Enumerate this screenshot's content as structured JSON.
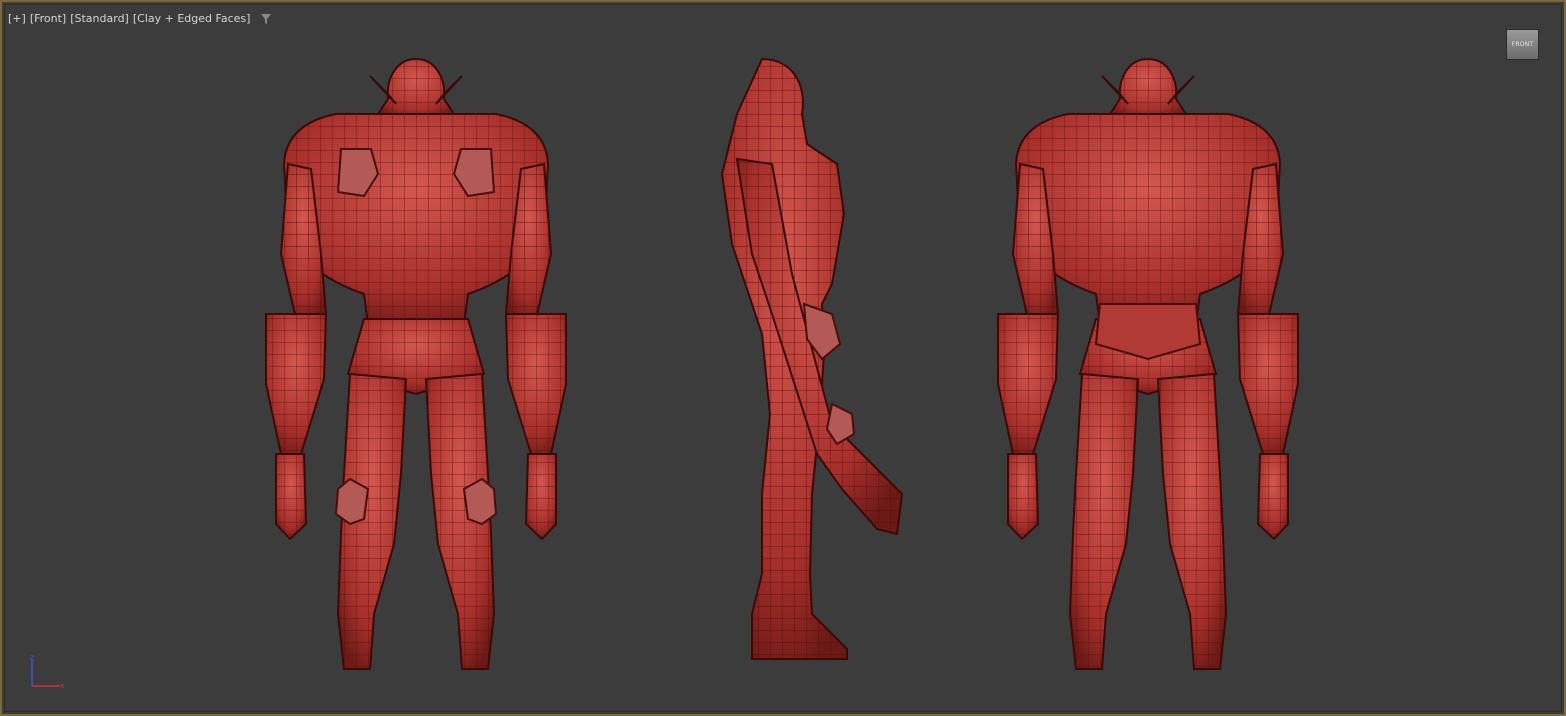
{
  "viewport": {
    "label_parts": [
      "[+]",
      "[Front]",
      "[Standard]",
      "[Clay + Edged Faces]"
    ],
    "filter_icon": "filter-funnel-icon",
    "viewcube_label": "FRONT",
    "axis_labels": [
      "z",
      "x"
    ],
    "colors": {
      "background": "#3c3c3c",
      "active_border": "#7a6a3c",
      "model_base": "#a8302c",
      "model_highlight": "#d45850",
      "wire": "#4a0e0c",
      "axis_z": "#3a5ad8",
      "axis_x": "#d03030"
    }
  },
  "models": [
    {
      "view": "front"
    },
    {
      "view": "side"
    },
    {
      "view": "back"
    }
  ]
}
